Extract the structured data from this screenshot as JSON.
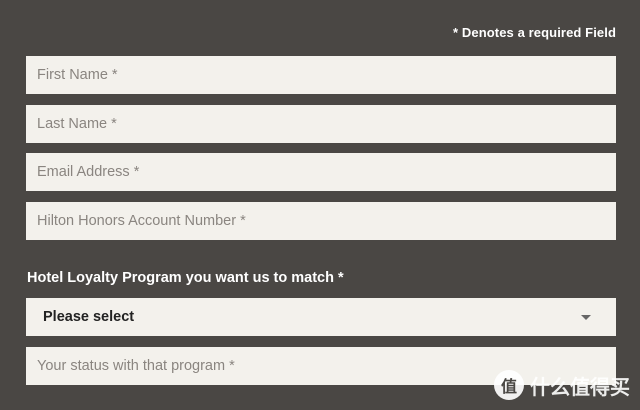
{
  "form": {
    "required_note": "* Denotes a required Field",
    "fields": {
      "first_name": {
        "placeholder": "First Name *",
        "value": ""
      },
      "last_name": {
        "placeholder": "Last Name *",
        "value": ""
      },
      "email": {
        "placeholder": "Email Address *",
        "value": ""
      },
      "hilton_account": {
        "placeholder": "Hilton Honors Account Number *",
        "value": ""
      },
      "status": {
        "placeholder": "Your status with that program *",
        "value": ""
      }
    },
    "loyalty_program": {
      "label": "Hotel Loyalty Program you want us to match *",
      "selected": "Please select"
    }
  },
  "watermark": {
    "logo_glyph": "值",
    "text": "什么值得买"
  },
  "colors": {
    "background": "#4a4744",
    "field_background": "#f3f1ec",
    "placeholder": "#8a8580"
  }
}
